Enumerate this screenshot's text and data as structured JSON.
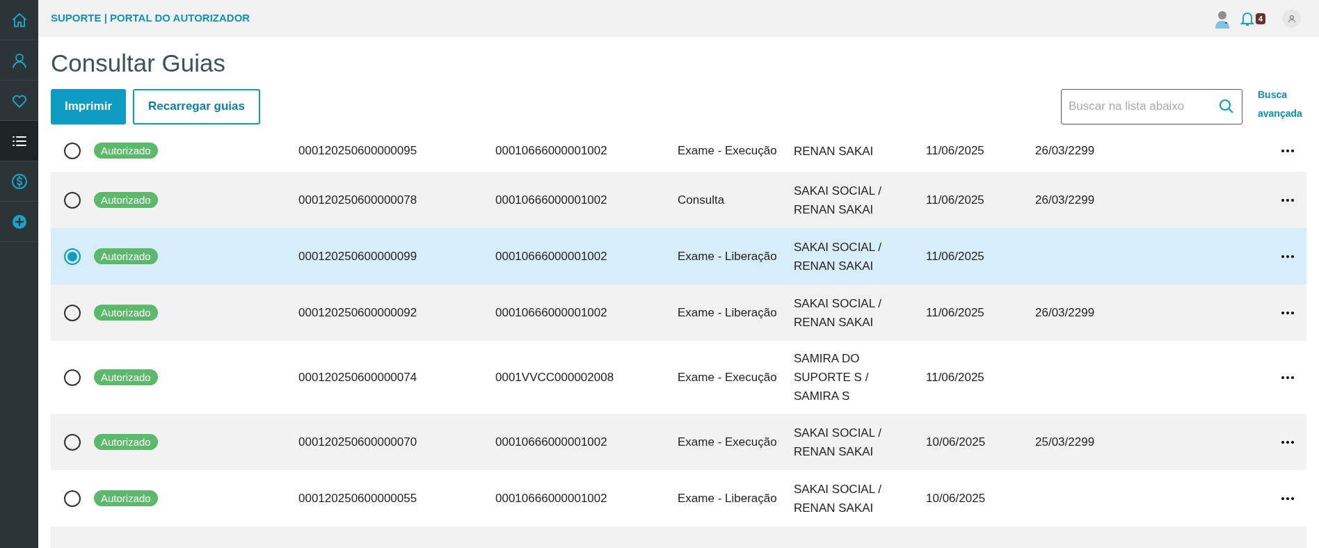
{
  "sidebar": {
    "items": [
      {
        "kind": "home",
        "selected": false
      },
      {
        "kind": "user",
        "selected": false
      },
      {
        "kind": "heart",
        "selected": false
      },
      {
        "kind": "list",
        "selected": true
      },
      {
        "kind": "dollar",
        "selected": false
      },
      {
        "kind": "plus",
        "selected": false
      }
    ]
  },
  "header": {
    "title": "SUPORTE | PORTAL DO AUTORIZADOR",
    "notifications": "4"
  },
  "page": {
    "title": "Consultar Guias"
  },
  "toolbar": {
    "buttons": [
      {
        "label": "Imprimir",
        "kind": "primary"
      },
      {
        "label": "Recarregar guias",
        "kind": "outline"
      }
    ],
    "search": {
      "placeholder": "Buscar na lista abaixo"
    },
    "advanced_link": "Busca avançada"
  },
  "table": {
    "rows": [
      {
        "selected": false,
        "status": "Autorizado",
        "guide": "000120250600000095",
        "number": "00010666000001002",
        "type": "Exame - Execução",
        "beneficiary": "RENAN SAKAI",
        "date": "11/06/2025",
        "validity": "26/03/2299",
        "partial": true
      },
      {
        "selected": false,
        "status": "Autorizado",
        "guide": "000120250600000078",
        "number": "00010666000001002",
        "type": "Consulta",
        "beneficiary": "SAKAI SOCIAL / RENAN SAKAI",
        "date": "11/06/2025",
        "validity": "26/03/2299"
      },
      {
        "selected": true,
        "status": "Autorizado",
        "guide": "000120250600000099",
        "number": "00010666000001002",
        "type": "Exame - Liberação",
        "beneficiary": "SAKAI SOCIAL / RENAN SAKAI",
        "date": "11/06/2025"
      },
      {
        "selected": false,
        "status": "Autorizado",
        "guide": "000120250600000092",
        "number": "00010666000001002",
        "type": "Exame - Liberação",
        "beneficiary": "SAKAI SOCIAL / RENAN SAKAI",
        "date": "11/06/2025",
        "validity": "26/03/2299"
      },
      {
        "selected": false,
        "status": "Autorizado",
        "guide": "000120250600000074",
        "number": "0001VVCC000002008",
        "type": "Exame - Execução",
        "beneficiary": "SAMIRA DO SUPORTE S / SAMIRA S",
        "date": "11/06/2025"
      },
      {
        "selected": false,
        "status": "Autorizado",
        "guide": "000120250600000070",
        "number": "00010666000001002",
        "type": "Exame - Execução",
        "beneficiary": "SAKAI SOCIAL / RENAN SAKAI",
        "date": "10/06/2025",
        "validity": "25/03/2299"
      },
      {
        "selected": false,
        "status": "Autorizado",
        "guide": "000120250600000055",
        "number": "00010666000001002",
        "type": "Exame - Liberação",
        "beneficiary": "SAKAI SOCIAL / RENAN SAKAI",
        "date": "10/06/2025"
      }
    ]
  }
}
